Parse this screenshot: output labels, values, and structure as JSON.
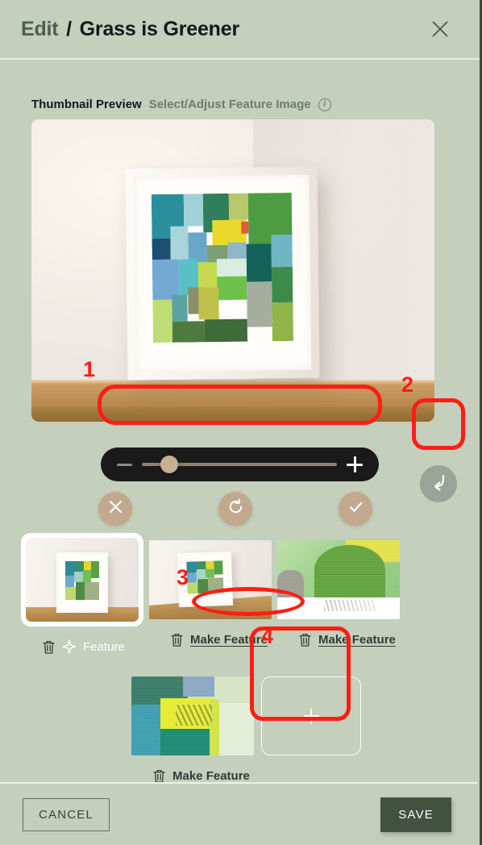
{
  "header": {
    "title_prefix": "Edit",
    "separator": "/",
    "title_name": "Grass is Greener",
    "close_icon": "close-icon"
  },
  "section": {
    "label_strong": "Thumbnail Preview",
    "label_muted": "Select/Adjust Feature Image",
    "info_icon_glyph": "i"
  },
  "zoom_slider": {
    "minus_label": "–",
    "plus_label": "+",
    "value_percent": 14,
    "min": 0,
    "max": 100
  },
  "crop_actions": [
    {
      "name": "cancel-crop",
      "icon": "close-icon"
    },
    {
      "name": "reset-crop",
      "icon": "rotate-ccw-icon"
    },
    {
      "name": "confirm-crop",
      "icon": "check-icon"
    }
  ],
  "undo_button": {
    "icon": "undo-arrow-icon"
  },
  "thumbnails": [
    {
      "id": "thumb-1",
      "selected": true,
      "caption": "Feature",
      "caption_state": "active",
      "has_sparkle": true,
      "alt": "Framed abstract green painting on wooden shelf"
    },
    {
      "id": "thumb-2",
      "selected": false,
      "caption": "Make Feature",
      "caption_state": "link",
      "has_sparkle": false,
      "alt": "Framed abstract painting angled on wooden shelf"
    },
    {
      "id": "thumb-3",
      "selected": false,
      "caption": "Make Feature",
      "caption_state": "link",
      "has_sparkle": false,
      "alt": "Close-up of green painting with artist signature"
    },
    {
      "id": "thumb-4",
      "selected": false,
      "caption": "Make Feature",
      "caption_state": "link",
      "has_sparkle": false,
      "alt": "Close-up detail of teal and yellow brushwork"
    }
  ],
  "add_image_tile": {
    "label": "+",
    "name": "add-image-tile"
  },
  "footer": {
    "cancel_label": "CANCEL",
    "save_label": "SAVE"
  },
  "annotations": [
    {
      "number": "1",
      "target": "zoom-slider"
    },
    {
      "number": "2",
      "target": "undo-button"
    },
    {
      "number": "3",
      "target": "make-feature-link-2"
    },
    {
      "number": "4",
      "target": "add-image-tile"
    }
  ],
  "colors": {
    "background": "#c4cfbc",
    "header_divider": "#e6ece2",
    "title_muted": "#4d5d51",
    "title_dark": "#15171a",
    "accent_tan": "#c0a98c",
    "save_green": "#41523f",
    "annotation_red": "#ff1e14",
    "slider_dark": "#1a1a1a"
  }
}
